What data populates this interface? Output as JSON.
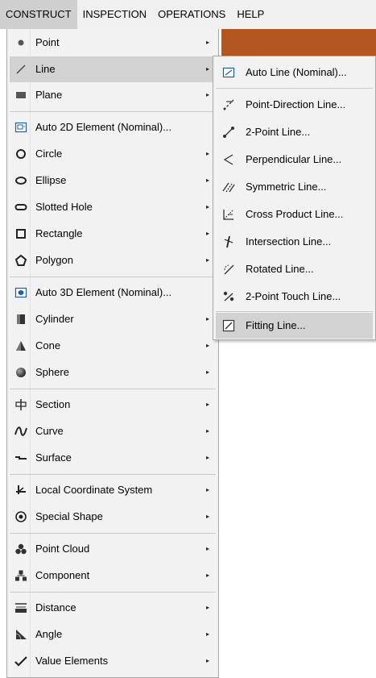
{
  "menubar": {
    "items": [
      "CONSTRUCT",
      "INSPECTION",
      "OPERATIONS",
      "HELP"
    ],
    "active_color": "#cfcfcf"
  },
  "construct_menu": {
    "items": [
      {
        "label": "Point",
        "icon": "point-dot-icon",
        "submenu": true
      },
      {
        "label": "Line",
        "icon": "line-icon",
        "submenu": true,
        "highlighted": true
      },
      {
        "label": "Plane",
        "icon": "plane-icon",
        "submenu": true
      },
      {
        "label": "Auto 2D Element (Nominal)...",
        "icon": "auto-2d-element-icon",
        "submenu": false
      },
      {
        "label": "Circle",
        "icon": "circle-icon",
        "submenu": true
      },
      {
        "label": "Ellipse",
        "icon": "ellipse-icon",
        "submenu": true
      },
      {
        "label": "Slotted Hole",
        "icon": "slotted-hole-icon",
        "submenu": true
      },
      {
        "label": "Rectangle",
        "icon": "rectangle-icon",
        "submenu": true
      },
      {
        "label": "Polygon",
        "icon": "polygon-icon",
        "submenu": true
      },
      {
        "label": "Auto 3D Element (Nominal)...",
        "icon": "auto-3d-element-icon",
        "submenu": false
      },
      {
        "label": "Cylinder",
        "icon": "cylinder-icon",
        "submenu": true
      },
      {
        "label": "Cone",
        "icon": "cone-icon",
        "submenu": true
      },
      {
        "label": "Sphere",
        "icon": "sphere-icon",
        "submenu": true
      },
      {
        "label": "Section",
        "icon": "section-icon",
        "submenu": true
      },
      {
        "label": "Curve",
        "icon": "curve-icon",
        "submenu": true
      },
      {
        "label": "Surface",
        "icon": "surface-icon",
        "submenu": true
      },
      {
        "label": "Local Coordinate System",
        "icon": "coordinate-system-icon",
        "submenu": true
      },
      {
        "label": "Special Shape",
        "icon": "special-shape-icon",
        "submenu": true
      },
      {
        "label": "Point Cloud",
        "icon": "point-cloud-icon",
        "submenu": true
      },
      {
        "label": "Component",
        "icon": "component-icon",
        "submenu": true
      },
      {
        "label": "Distance",
        "icon": "distance-icon",
        "submenu": true
      },
      {
        "label": "Angle",
        "icon": "angle-icon",
        "submenu": true
      },
      {
        "label": "Value Elements",
        "icon": "value-elements-icon",
        "submenu": true
      }
    ]
  },
  "line_submenu": {
    "items": [
      {
        "label": "Auto Line (Nominal)...",
        "icon": "auto-line-icon"
      },
      {
        "label": "Point-Direction Line...",
        "icon": "point-direction-line-icon"
      },
      {
        "label": "2-Point Line...",
        "icon": "two-point-line-icon"
      },
      {
        "label": "Perpendicular Line...",
        "icon": "perpendicular-line-icon"
      },
      {
        "label": "Symmetric Line...",
        "icon": "symmetric-line-icon"
      },
      {
        "label": "Cross Product Line...",
        "icon": "cross-product-line-icon"
      },
      {
        "label": "Intersection Line...",
        "icon": "intersection-line-icon"
      },
      {
        "label": "Rotated Line...",
        "icon": "rotated-line-icon"
      },
      {
        "label": "2-Point Touch Line...",
        "icon": "two-point-touch-line-icon"
      },
      {
        "label": "Fitting Line...",
        "icon": "fitting-line-icon",
        "highlighted": true
      }
    ]
  },
  "colors": {
    "menu_bg": "#f2f2f2",
    "highlight": "#d2d2d2",
    "app_accent": "#b3561f",
    "icon_blue": "#1f5fa8"
  },
  "submenu_arrow": "▸"
}
